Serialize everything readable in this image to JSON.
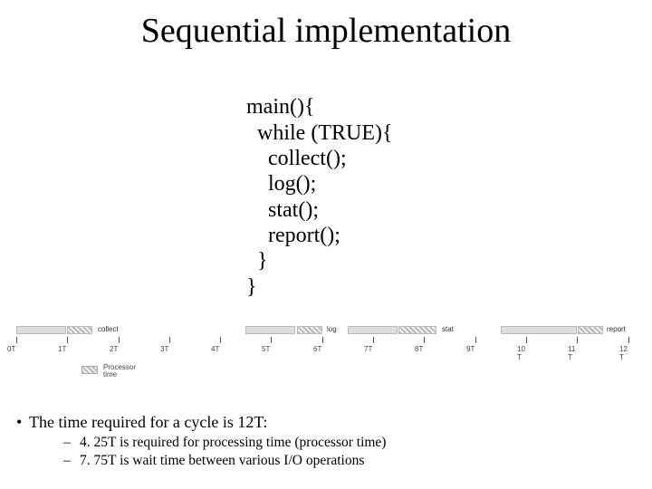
{
  "title": "Sequential implementation",
  "code": {
    "l1": "main(){",
    "l2": "  while (TRUE){",
    "l3": "    collect();",
    "l4": "    log();",
    "l5": "    stat();",
    "l6": "    report();",
    "l7": "  }",
    "l8": "}"
  },
  "timeline": {
    "ticks": [
      "0T",
      "1T",
      "2T",
      "3T",
      "4T",
      "5T",
      "6T",
      "7T",
      "8T",
      "9T",
      "10\nT",
      "11\nT",
      "12\nT"
    ],
    "labels": {
      "collect": "collect",
      "log": "log",
      "stat": "stat",
      "report": "report"
    },
    "legend": "Processor\ntime"
  },
  "chart_data": {
    "type": "bar",
    "title": "",
    "xlabel": "",
    "ylabel": "",
    "categories": [
      "0T",
      "1T",
      "2T",
      "3T",
      "4T",
      "5T",
      "6T",
      "7T",
      "8T",
      "9T",
      "10T",
      "11T",
      "12T"
    ],
    "xlim": [
      0,
      12
    ],
    "series": [
      {
        "name": "io-wait",
        "segments": [
          [
            0,
            1
          ],
          [
            4.5,
            5.5
          ],
          [
            6.5,
            7.5
          ],
          [
            9.5,
            11
          ]
        ]
      },
      {
        "name": "processor-time",
        "segments": [
          [
            1,
            1.5
          ],
          [
            5.5,
            6
          ],
          [
            7.5,
            8.25
          ],
          [
            11,
            11.5
          ]
        ]
      }
    ],
    "labels": [
      {
        "text": "collect",
        "x": 1.6
      },
      {
        "text": "log",
        "x": 6.1
      },
      {
        "text": "stat",
        "x": 8.4
      },
      {
        "text": "report",
        "x": 11.6
      }
    ],
    "legend": [
      "Processor time"
    ],
    "totals": {
      "cycle_T": 12,
      "processor_T": 4.25,
      "wait_T": 7.75
    }
  },
  "bullet": {
    "main": "The time required for a cycle is 12T:",
    "sub1": "4. 25T is required for processing time (processor time)",
    "sub2": "7. 75T is wait time between various I/O operations"
  }
}
